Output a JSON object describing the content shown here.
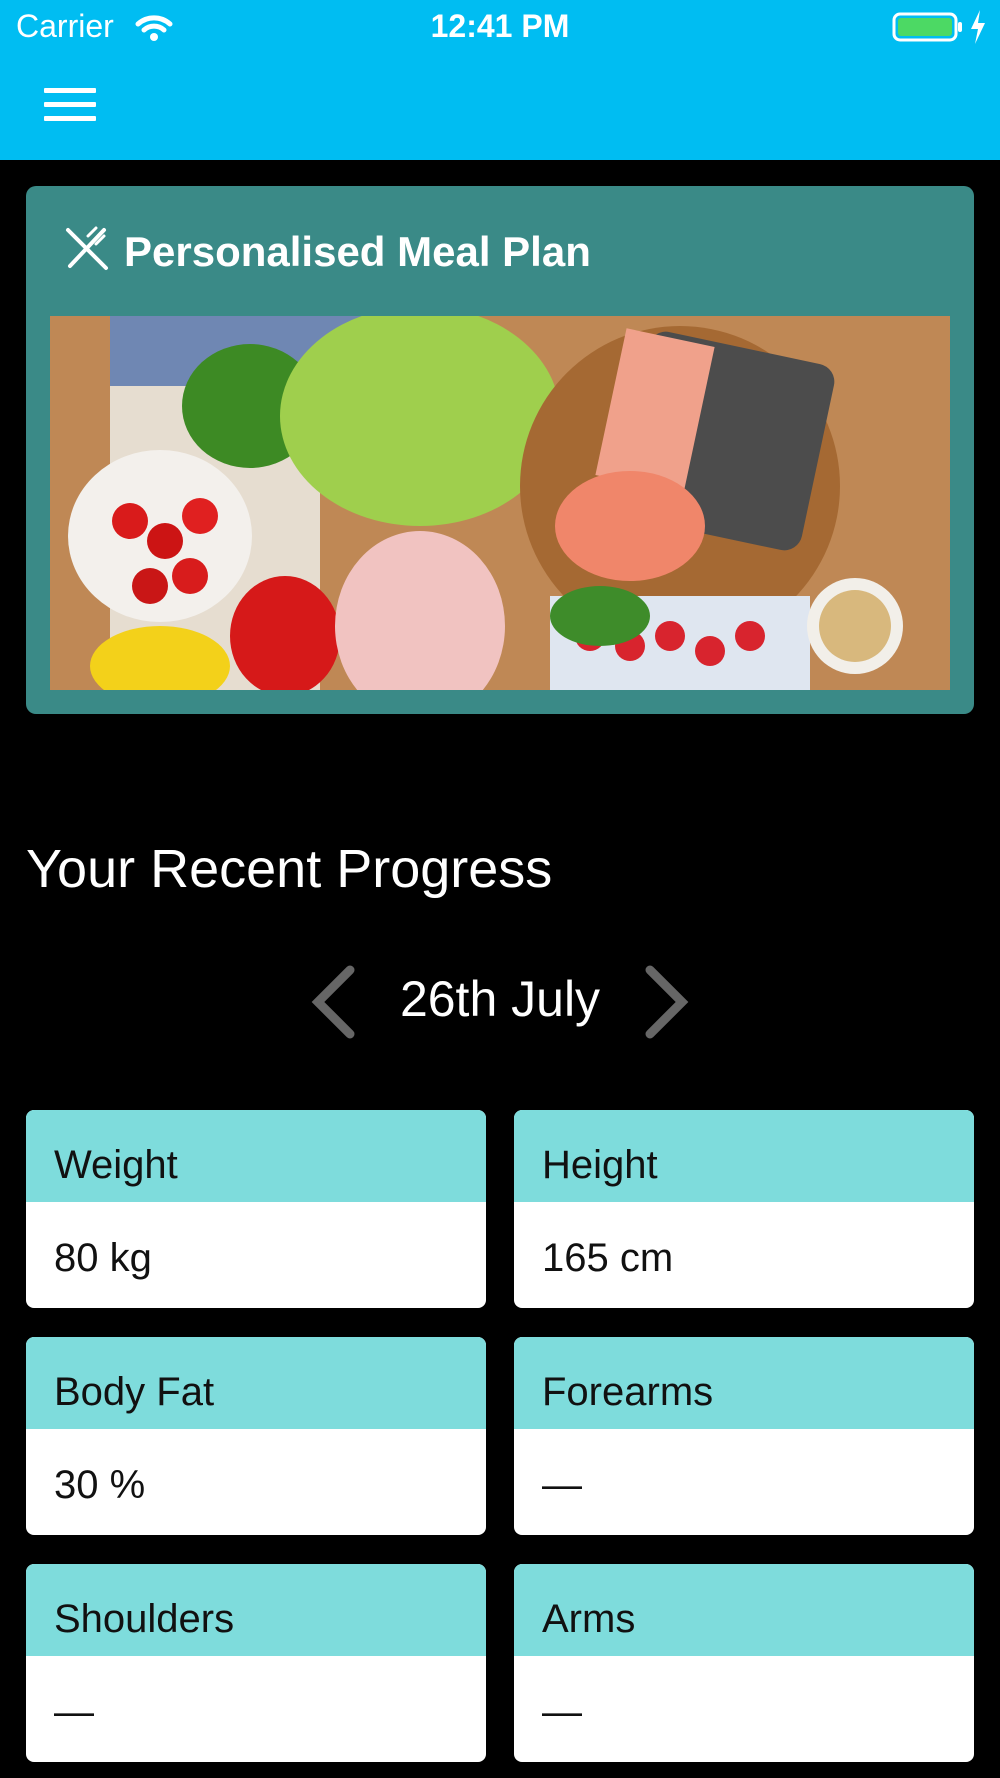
{
  "status_bar": {
    "carrier": "Carrier",
    "time": "12:41 PM"
  },
  "nav": {
    "menu_icon": "hamburger-menu-icon"
  },
  "meal_plan": {
    "icon": "fork-knife-icon",
    "title": "Personalised Meal Plan",
    "image": "healthy-food-photo"
  },
  "progress": {
    "title": "Your Recent Progress",
    "date": "26th July",
    "prev_icon": "chevron-left-icon",
    "next_icon": "chevron-right-icon",
    "stats": [
      {
        "label": "Weight",
        "value": "80 kg"
      },
      {
        "label": "Height",
        "value": "165 cm"
      },
      {
        "label": "Body Fat",
        "value": "30 %"
      },
      {
        "label": "Forearms",
        "value": "—"
      },
      {
        "label": "Shoulders",
        "value": "—"
      },
      {
        "label": "Arms",
        "value": "—"
      }
    ]
  },
  "colors": {
    "header": "#00BDF2",
    "meal_card": "#3A8A87",
    "stat_header": "#7EDCDC",
    "background": "#000000"
  }
}
